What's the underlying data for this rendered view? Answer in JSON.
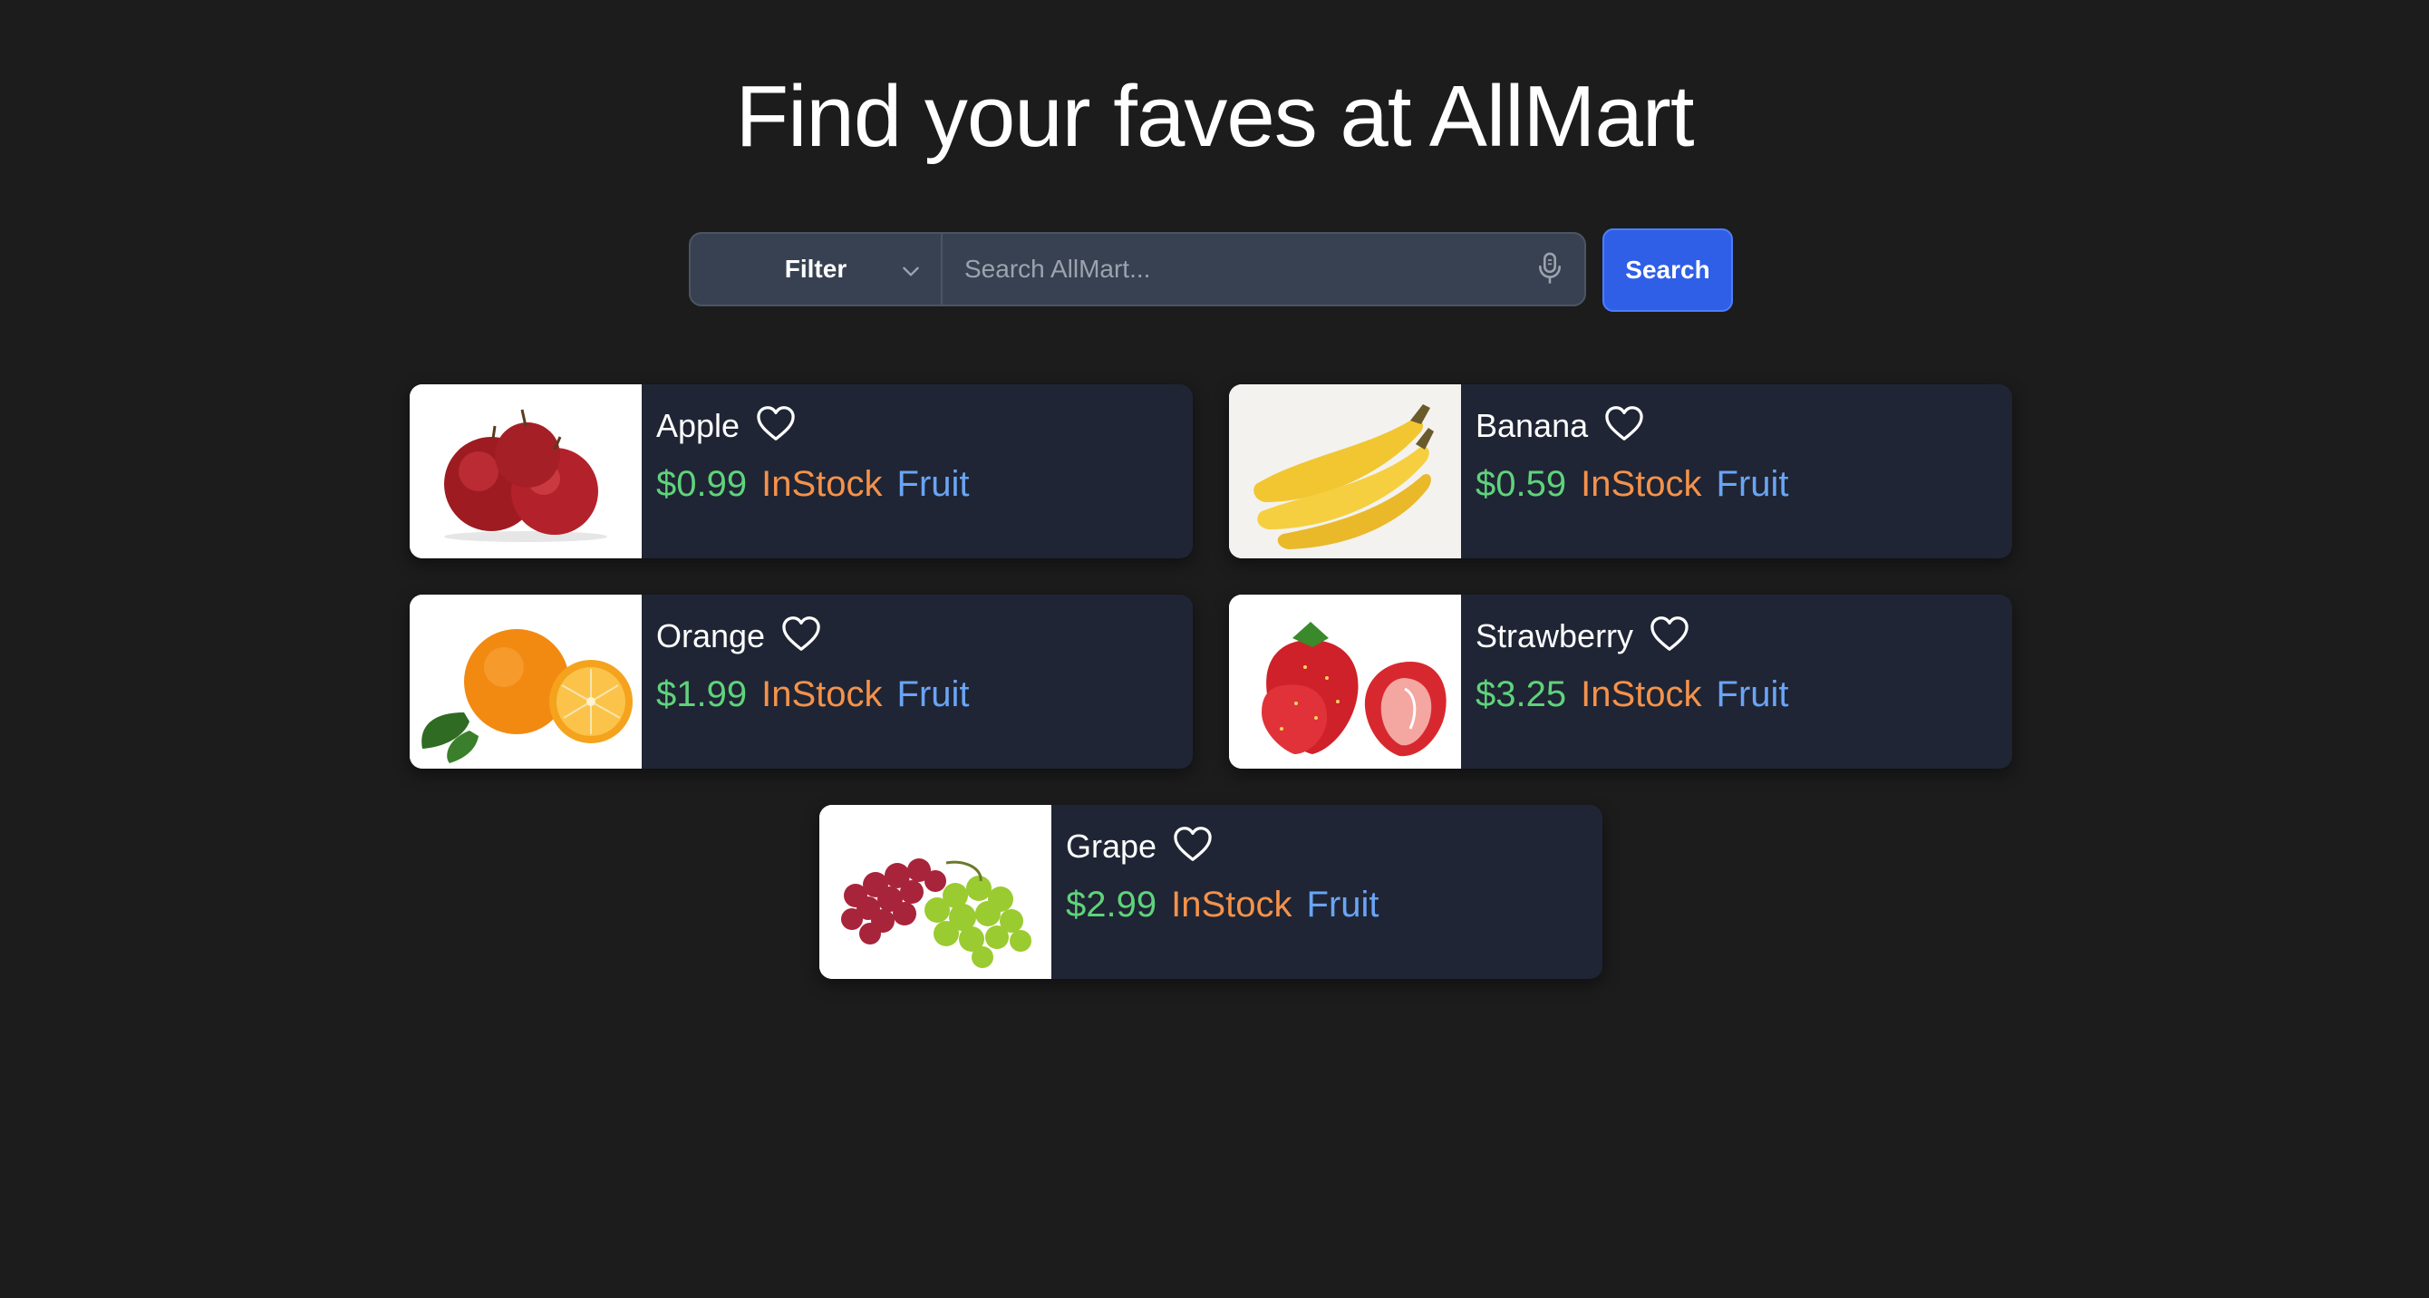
{
  "header": {
    "title": "Find your faves at AllMart"
  },
  "search": {
    "filter_label": "Filter",
    "placeholder": "Search AllMart...",
    "value": "",
    "button_label": "Search"
  },
  "colors": {
    "background": "#1c1c1c",
    "card": "#1f2534",
    "price": "#5fd37b",
    "stock": "#f5924a",
    "category": "#6aa4f5",
    "button": "#2f5fe6"
  },
  "products": [
    {
      "name": "Apple",
      "price": "$0.99",
      "stock": "InStock",
      "category": "Fruit",
      "image": "apple-image",
      "favorite_icon": "heart-outline-icon"
    },
    {
      "name": "Banana",
      "price": "$0.59",
      "stock": "InStock",
      "category": "Fruit",
      "image": "banana-image",
      "favorite_icon": "heart-outline-icon"
    },
    {
      "name": "Orange",
      "price": "$1.99",
      "stock": "InStock",
      "category": "Fruit",
      "image": "orange-image",
      "favorite_icon": "heart-outline-icon"
    },
    {
      "name": "Strawberry",
      "price": "$3.25",
      "stock": "InStock",
      "category": "Fruit",
      "image": "strawberry-image",
      "favorite_icon": "heart-outline-icon"
    },
    {
      "name": "Grape",
      "price": "$2.99",
      "stock": "InStock",
      "category": "Fruit",
      "image": "grape-image",
      "favorite_icon": "heart-outline-icon"
    }
  ]
}
